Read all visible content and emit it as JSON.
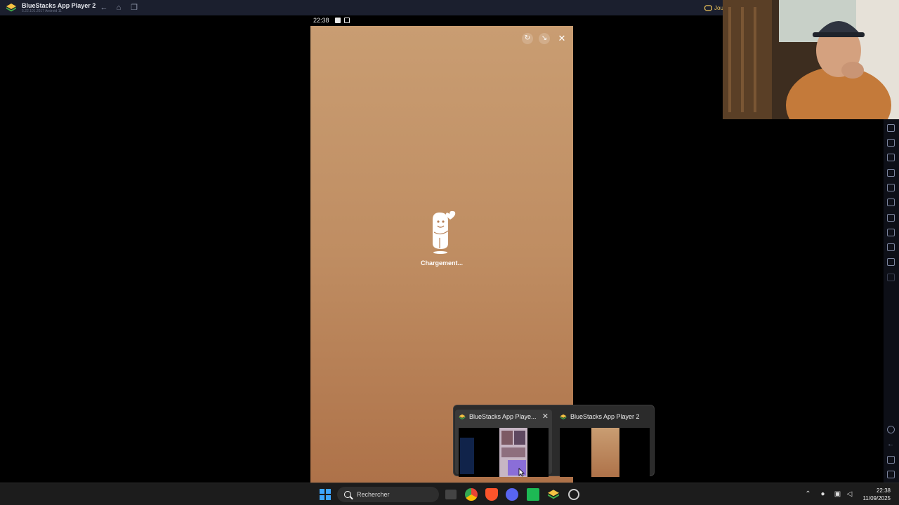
{
  "window": {
    "title": "BlueStacks App Player 2",
    "version": "5.22.101.2017  Android 11",
    "game_pill": "Jou"
  },
  "status_bar": {
    "time": "22:38"
  },
  "screen": {
    "loading_text": "Chargement..."
  },
  "preview": {
    "cards": [
      {
        "title": "BlueStacks App Playe...",
        "close": "✕"
      },
      {
        "title": "BlueStacks App Player 2"
      }
    ]
  },
  "taskbar": {
    "search_placeholder": "Rechercher",
    "clock_time": "22:38",
    "clock_date": "11/09/2025"
  },
  "icons": {
    "back": "arrow-left-icon",
    "home": "home-icon",
    "multitask": "multitask-icon"
  },
  "colors": {
    "titlebar": "#1b1f2e",
    "screen_top": "#c99d72",
    "screen_bottom": "#ae7249",
    "accent_blue": "#3ea6ff"
  }
}
